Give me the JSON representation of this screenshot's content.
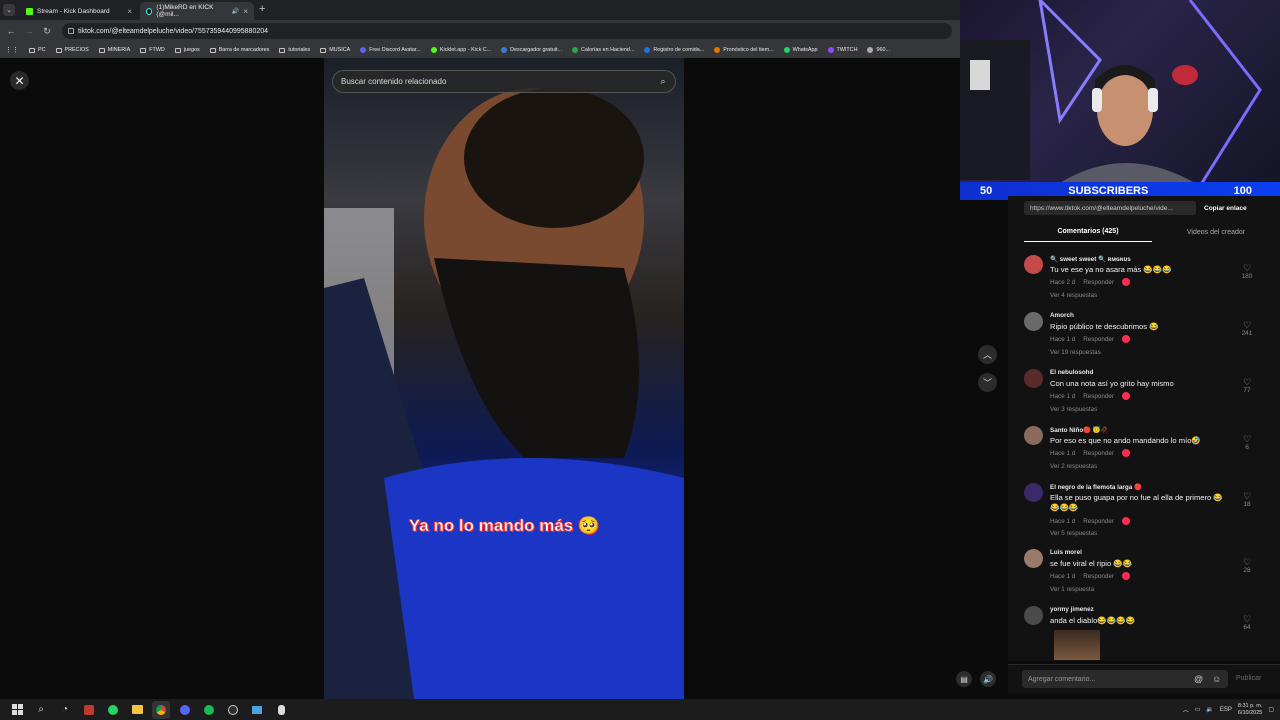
{
  "tabs": [
    {
      "title": "Stream - Kick Dashboard",
      "close": "×"
    },
    {
      "title": "(1)MikeRD en KICK (@mil...",
      "close": "×"
    }
  ],
  "new_tab": "+",
  "url": "tiktok.com/@elteamdelpeluche/video/7557359440995880204",
  "bookmarks": [
    "PC",
    "PRECIOS",
    "MINERIA",
    "FTWD",
    "juegos",
    "Barra de marcadores",
    "tutoriales",
    "MUSICA",
    "Free Discord Avatar...",
    "Kicklet.app - Kick C...",
    "Descargador gratuit...",
    "Calorías en Haciend...",
    "Registro de comida...",
    "Pronóstico del tiem...",
    "WhatsApp",
    "TWITCH",
    "960..."
  ],
  "player": {
    "search_placeholder": "Buscar contenido relacionado",
    "caption": "Ya no lo mando más 🥺",
    "close": "✕",
    "nav_up": "︿",
    "nav_down": "﹀"
  },
  "overlay": {
    "left_count": "50",
    "label": "SUBSCRIBERS",
    "right_count": "100"
  },
  "panel": {
    "link": "https://www.tiktok.com/@elteamdelpeluche/vide...",
    "copy": "Copiar enlace",
    "tab_comments": "Comentarios (425)",
    "tab_creator": "Videos del creador",
    "reply_label": "Responder",
    "comments": [
      {
        "name": "🔍 sweet sweet 🔍 ʀᴍɢɴᴜs",
        "text": "Tu ve ese ya no asara más 😂😂😂",
        "time": "Hace 2 d",
        "replies": "Ver 4 respuestas",
        "likes": "180",
        "avatar": "#c44a4a"
      },
      {
        "name": "Amorch",
        "text": "Ripio público te descubrimos 😂",
        "time": "Hace 1 d",
        "replies": "Ver 19 respuestas",
        "likes": "241",
        "avatar": "#6a6a6a"
      },
      {
        "name": "El nebulosohd",
        "text": "Con una nota así yo grito hay mismo",
        "time": "Hace 1 d",
        "replies": "Ver 3 respuestas",
        "likes": "77",
        "avatar": "#5a2b2b"
      },
      {
        "name": "Santo Niño🔴 😇🥀",
        "text": "Por eso es que no ando mandando lo mío🤣",
        "time": "Hace 1 d",
        "replies": "Ver 2 respuestas",
        "likes": "6",
        "avatar": "#8a6a5a"
      },
      {
        "name": "El negro de la flemota larga 🔴",
        "text": "Ella se puso guapa por no fue al ella de primero 😂",
        "text2": "😂😂😂",
        "time": "Hace 1 d",
        "replies": "Ver 5 respuestas",
        "likes": "18",
        "avatar": "#3a2a6a"
      },
      {
        "name": "Luis morel",
        "text": "se fue viral el ripio 😂😂",
        "time": "Hace 1 d",
        "replies": "Ver 1 respuesta",
        "likes": "28",
        "avatar": "#9a7a6a"
      },
      {
        "name": "yormy jimenez",
        "text": "anda el diablo😂😂😂😂",
        "likes": "64",
        "avatar": "#4a4a4a"
      }
    ],
    "add_placeholder": "Agregar comentario...",
    "publish": "Publicar"
  },
  "taskbar": {
    "lang": "ESP",
    "time": "8:31 p. m.",
    "date": "6/10/2025"
  }
}
